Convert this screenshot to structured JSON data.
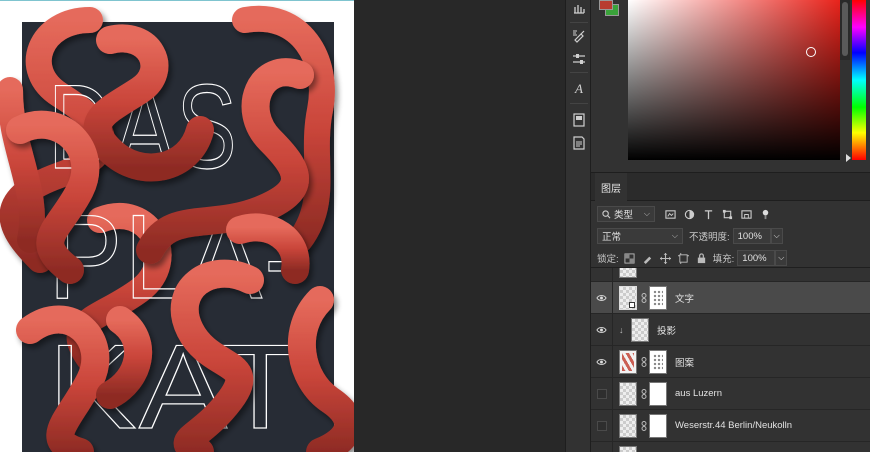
{
  "poster": {
    "lines": [
      "DAS",
      "PLA-",
      "KAT"
    ],
    "background_color": "#272c35",
    "accent_color": "#c9453a"
  },
  "toolstrip": {
    "icons": [
      "history-icon",
      "brushes-icon",
      "adjust-icon",
      "character-icon",
      "properties-icon",
      "notes-icon"
    ]
  },
  "color_panel": {
    "foreground": "#b83c30",
    "background": "#3aa33a"
  },
  "layers": {
    "tab_label": "图层",
    "filter": {
      "kind_label": "类型"
    },
    "blend_mode": "正常",
    "opacity_label": "不透明度:",
    "opacity_value": "100%",
    "lock_label": "锁定:",
    "fill_label": "填充:",
    "fill_value": "100%",
    "items": [
      {
        "name": "文字",
        "visible": true,
        "selected": true
      },
      {
        "name": "投影",
        "visible": true,
        "selected": false
      },
      {
        "name": "图案",
        "visible": true,
        "selected": false
      },
      {
        "name": "aus Luzern",
        "visible": false,
        "selected": false
      },
      {
        "name": "Weserstr.44 Berlin/Neukolln",
        "visible": false,
        "selected": false
      }
    ]
  }
}
